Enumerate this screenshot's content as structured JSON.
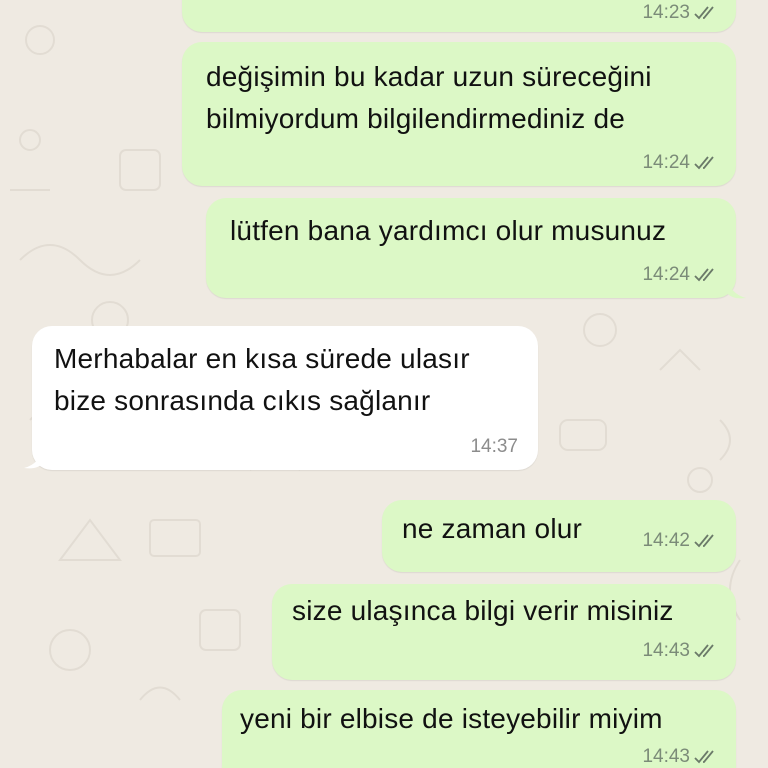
{
  "colors": {
    "outgoing_bubble": "#dcf8c6",
    "incoming_bubble": "#ffffff",
    "background": "#efeae2",
    "timestamp": "#7b8b78",
    "ticks": "#6b7a69"
  },
  "messages": [
    {
      "direction": "outgoing",
      "lines": [],
      "time": "14:23",
      "status": "sent-double-tick"
    },
    {
      "direction": "outgoing",
      "lines": [
        "değişimin bu kadar uzun süreceğini",
        "bilmiyordum bilgilendirmediniz de"
      ],
      "time": "14:24",
      "status": "sent-double-tick"
    },
    {
      "direction": "outgoing",
      "lines": [
        "lütfen bana yardımcı olur musunuz"
      ],
      "time": "14:24",
      "status": "sent-double-tick"
    },
    {
      "direction": "incoming",
      "lines": [
        "Merhabalar en kısa sürede ulasır",
        "bize sonrasında cıkıs sağlanır"
      ],
      "time": "14:37"
    },
    {
      "direction": "outgoing",
      "lines": [
        "ne zaman olur"
      ],
      "time": "14:42",
      "status": "sent-double-tick"
    },
    {
      "direction": "outgoing",
      "lines": [
        "size ulaşınca bilgi verir misiniz"
      ],
      "time": "14:43",
      "status": "sent-double-tick"
    },
    {
      "direction": "outgoing",
      "lines": [
        "yeni bir elbise de isteyebilir miyim"
      ],
      "time": "14:43",
      "status": "sent-double-tick"
    }
  ]
}
